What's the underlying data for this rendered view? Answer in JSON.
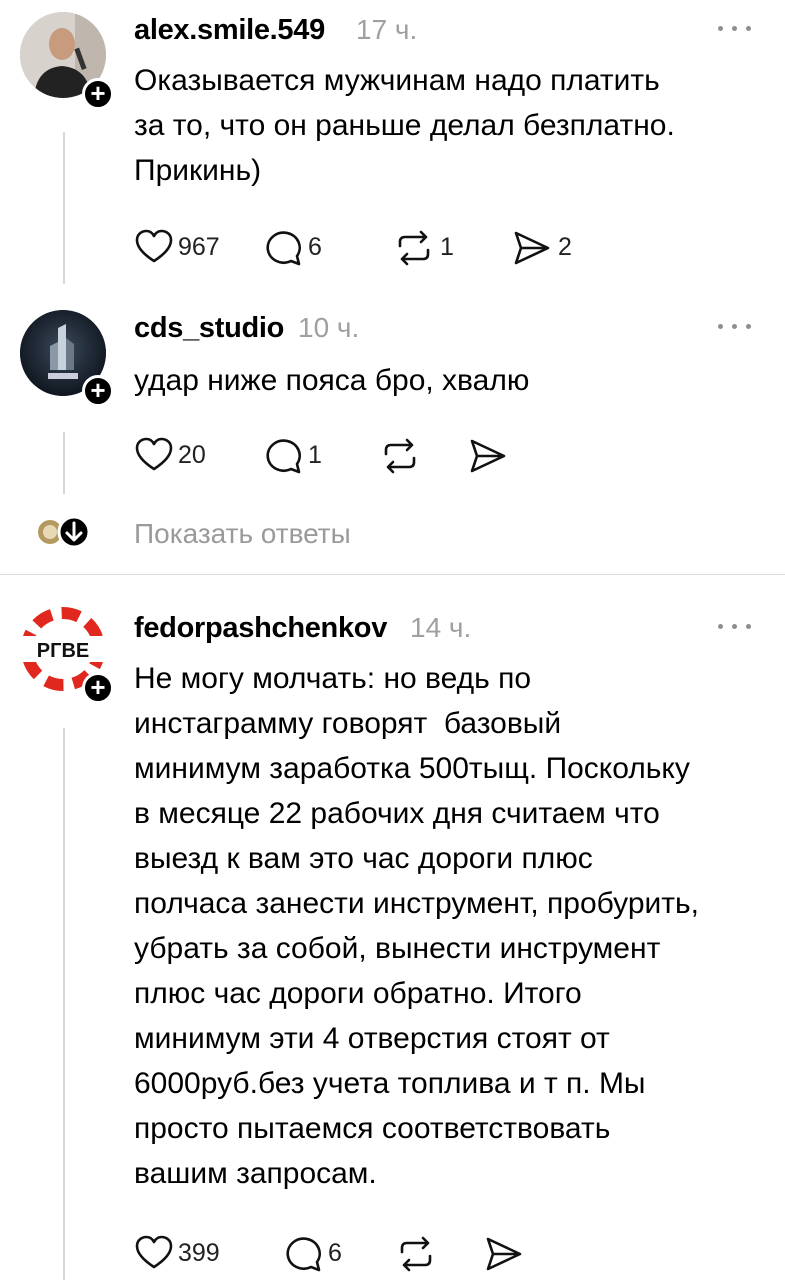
{
  "comments": [
    {
      "username": "alex.smile.549",
      "time": "17 ч.",
      "text": "Оказывается мужчинам надо платить\nза то, что он раньше делал безплатно.\nПрикинь)",
      "likes": "967",
      "replies": "6",
      "reposts": "1",
      "shares": "2",
      "avatar_icon": "person-photo-avatar"
    },
    {
      "username": "cds_studio",
      "time": "10 ч.",
      "text": "удар ниже пояса бро, хвалю",
      "likes": "20",
      "replies": "1",
      "reposts": "",
      "shares": "",
      "avatar_icon": "cds-logo-avatar"
    },
    {
      "username": "fedorpashchenkov",
      "time": "14 ч.",
      "text": "Не могу молчать: но ведь по\nинстаграмму говорят  базовый\nминимум заработка 500тыщ. Поскольку\nв месяце 22 рабочих дня считаем что\nвыезд к вам это час дороги плюс\nполчаса занести инструмент, пробурить,\nубрать за собой, вынести инструмент\nплюс час дороги обратно. Итого\nминимум эти 4 отверстия стоят от\n6000руб.без учета топлива и т п. Мы\nпросто пытаемся соответствовать\nвашим запросам.",
      "likes": "399",
      "replies": "6",
      "reposts": "",
      "shares": "",
      "avatar_text": "РГВЕ",
      "avatar_icon": "lifebuoy-logo-avatar"
    }
  ],
  "show_replies": "Показать ответы",
  "colors": {
    "accent": "#000000",
    "muted": "#a0a0a0",
    "lifebuoy_red": "#e0281e"
  }
}
